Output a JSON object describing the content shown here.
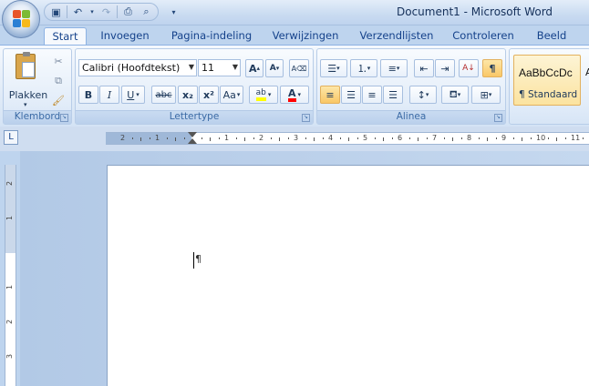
{
  "window": {
    "title": "Document1 - Microsoft Word"
  },
  "quick_access": {
    "icons": [
      "save-icon",
      "undo-icon",
      "redo-icon",
      "print-icon",
      "print-preview-icon",
      "customize-qat-icon"
    ]
  },
  "tabs": [
    "Start",
    "Invoegen",
    "Pagina-indeling",
    "Verwijzingen",
    "Verzendlijsten",
    "Controleren",
    "Beeld"
  ],
  "active_tab": "Start",
  "ribbon": {
    "clipboard": {
      "label": "Klembord",
      "paste_label": "Plakken"
    },
    "font": {
      "label": "Lettertype",
      "font_name": "Calibri (Hoofdtekst)",
      "font_size": "11",
      "bold": "B",
      "italic": "I",
      "underline": "U",
      "strike": "abc",
      "subscript": "x₂",
      "superscript": "x²",
      "change_case": "Aa",
      "highlight": "ab",
      "font_color": "A"
    },
    "paragraph": {
      "label": "Alinea",
      "pilcrow": "¶"
    },
    "styles": {
      "preview": "AaBbCcDc",
      "name": "¶ Standaard",
      "partial_preview": "A"
    }
  },
  "colors": {
    "highlight": "#ffff00",
    "font_color": "#ff0000",
    "active_toggle": "#f9c766"
  },
  "ruler": {
    "h_ticks": [
      "2",
      "1",
      "1",
      "2",
      "3",
      "4",
      "5",
      "6",
      "7",
      "8",
      "9",
      "10",
      "11"
    ],
    "v_ticks": [
      "2",
      "1",
      "1",
      "2",
      "3"
    ]
  },
  "document": {
    "paragraph_mark": "¶"
  }
}
